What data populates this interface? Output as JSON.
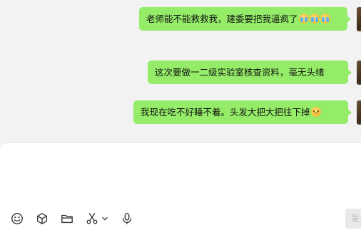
{
  "messages": [
    {
      "text": "老师能不能救救我，建委要把我逼疯了",
      "emojis": [
        "crying-face",
        "crying-face",
        "crying-face"
      ]
    },
    {
      "text": "这次要做一二级实验室核查资料，毫无头绪",
      "emojis": []
    },
    {
      "text": "我现在吃不好睡不着。头发大把大把往下掉",
      "emojis": [
        "disappointed-face"
      ]
    }
  ],
  "input": {
    "value": ""
  },
  "toolbar": {
    "icons": [
      "emoji-icon",
      "box-icon",
      "folder-icon",
      "scissors-icon",
      "chevron-down-icon",
      "microphone-icon"
    ]
  },
  "send": {
    "label": "发"
  }
}
